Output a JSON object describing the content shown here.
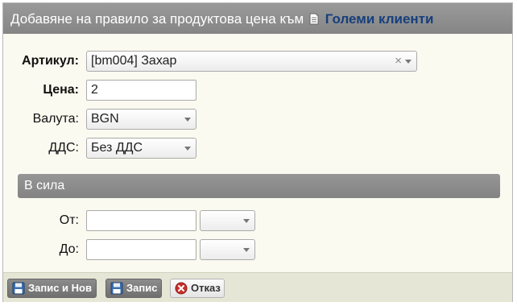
{
  "dialog": {
    "title_prefix": "Добавяне на правило за продуктова цена към",
    "title_link": "Големи клиенти"
  },
  "form": {
    "article_label": "Артикул:",
    "article_value": "[bm004] Захар",
    "price_label": "Цена:",
    "price_value": "2",
    "currency_label": "Валута:",
    "currency_value": "BGN",
    "vat_label": "ДДС:",
    "vat_value": "Без ДДС"
  },
  "validity": {
    "section_title": "В сила",
    "from_label": "От:",
    "from_date": "",
    "from_time": "",
    "to_label": "До:",
    "to_date": "",
    "to_time": ""
  },
  "footer": {
    "save_new_label": "Запис и Нов",
    "save_label": "Запис",
    "cancel_label": "Отказ"
  },
  "icons": {
    "title_doc": "document-icon",
    "save": "floppy-disk-icon",
    "cancel": "cancel-circle-icon"
  }
}
